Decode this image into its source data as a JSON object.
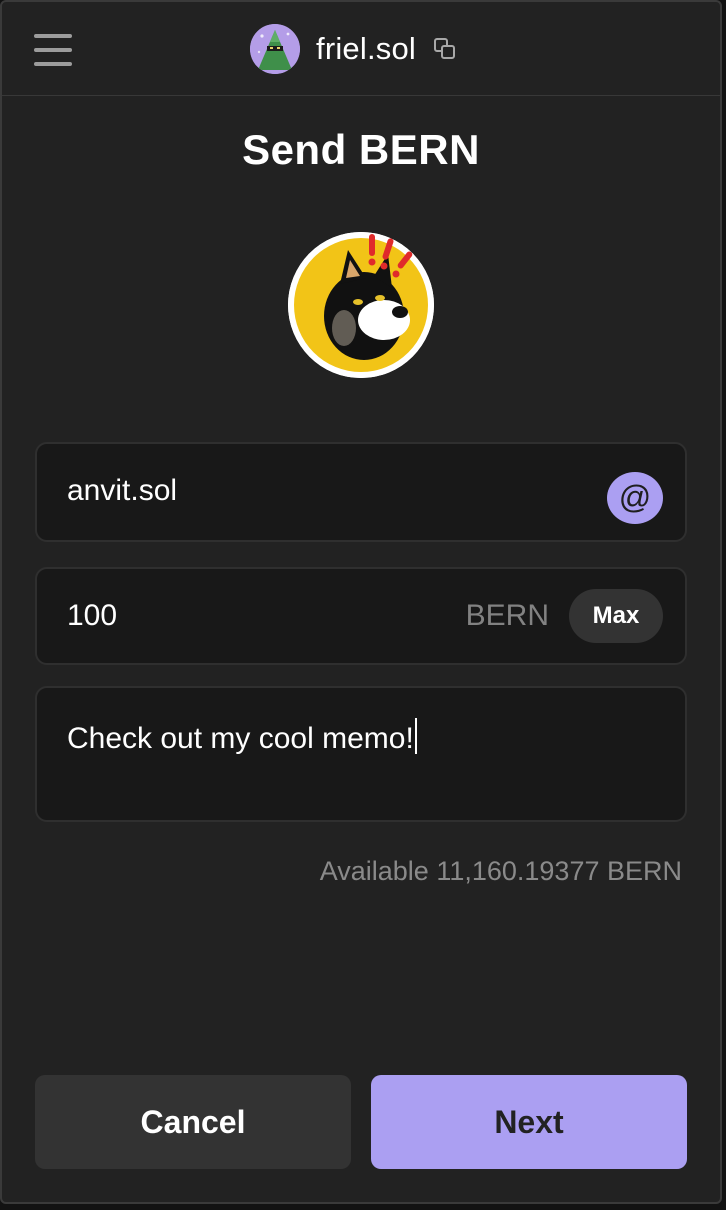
{
  "header": {
    "account_name": "friel.sol",
    "menu_icon": "hamburger-menu-icon",
    "copy_icon": "copy-icon"
  },
  "title": "Send BERN",
  "token": {
    "logo_icon": "bern-token-logo"
  },
  "recipient": {
    "value": "anvit.sol",
    "domain_button_label": "@"
  },
  "amount": {
    "value": "100",
    "unit": "BERN",
    "max_label": "Max"
  },
  "memo": {
    "value": "Check out my cool memo!"
  },
  "available_text": "Available 11,160.19377 BERN",
  "buttons": {
    "cancel_label": "Cancel",
    "next_label": "Next"
  },
  "colors": {
    "accent": "#ab9ff2",
    "background": "#222222",
    "field_background": "#181818",
    "muted_text": "#8a8a8a"
  }
}
